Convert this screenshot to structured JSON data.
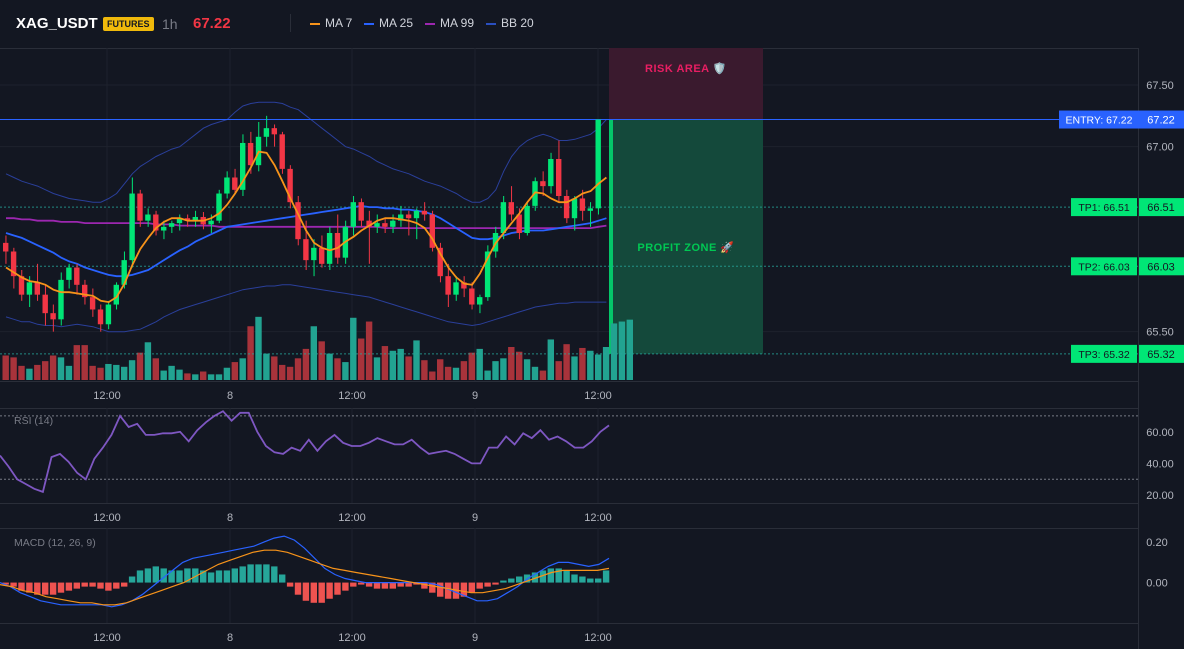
{
  "header": {
    "symbol": "XAG_USDT",
    "badge": "FUTURES",
    "timeframe": "1h",
    "price": "67.22",
    "legend": [
      {
        "label": "MA 7",
        "color": "#f7931a"
      },
      {
        "label": "MA 25",
        "color": "#2962ff"
      },
      {
        "label": "MA 99",
        "color": "#9c27b0"
      },
      {
        "label": "BB 20",
        "color": "#2a4fc0"
      }
    ]
  },
  "colors": {
    "up": "#00e676",
    "down": "#f23645",
    "up_vol": "#22a391",
    "down_vol": "#a8333b"
  },
  "chart_data": [
    {
      "type": "candlestick",
      "symbol": "XAG_USDT",
      "interval": "1h",
      "x_labels": [
        "12:00",
        "8",
        "12:00",
        "9",
        "12:00"
      ],
      "y_ticks": [
        "67.50",
        "67.00",
        "65.50"
      ],
      "ylim": [
        65.1,
        67.8
      ],
      "candles": [
        [
          66.22,
          66.28,
          66.05,
          66.15
        ],
        [
          66.15,
          66.18,
          65.85,
          65.95
        ],
        [
          65.95,
          66.0,
          65.75,
          65.8
        ],
        [
          65.8,
          65.95,
          65.7,
          65.9
        ],
        [
          65.9,
          66.05,
          65.75,
          65.8
        ],
        [
          65.8,
          65.88,
          65.55,
          65.65
        ],
        [
          65.65,
          65.72,
          65.5,
          65.6
        ],
        [
          65.6,
          65.98,
          65.55,
          65.92
        ],
        [
          65.92,
          66.05,
          65.85,
          66.02
        ],
        [
          66.02,
          66.05,
          65.8,
          65.88
        ],
        [
          65.88,
          65.92,
          65.72,
          65.78
        ],
        [
          65.78,
          65.85,
          65.62,
          65.68
        ],
        [
          65.68,
          65.72,
          65.5,
          65.56
        ],
        [
          65.56,
          65.75,
          65.52,
          65.72
        ],
        [
          65.72,
          65.9,
          65.68,
          65.88
        ],
        [
          65.88,
          66.15,
          65.85,
          66.08
        ],
        [
          66.08,
          66.75,
          66.02,
          66.62
        ],
        [
          66.62,
          66.65,
          66.35,
          66.4
        ],
        [
          66.4,
          66.5,
          66.35,
          66.45
        ],
        [
          66.45,
          66.48,
          66.28,
          66.32
        ],
        [
          66.32,
          66.4,
          66.25,
          66.35
        ],
        [
          66.35,
          66.4,
          66.3,
          66.38
        ],
        [
          66.38,
          66.45,
          66.32,
          66.42
        ],
        [
          66.42,
          66.45,
          66.35,
          66.4
        ],
        [
          66.4,
          66.48,
          66.35,
          66.43
        ],
        [
          66.43,
          66.47,
          66.33,
          66.37
        ],
        [
          66.37,
          66.45,
          66.3,
          66.4
        ],
        [
          66.4,
          66.65,
          66.38,
          66.62
        ],
        [
          66.62,
          66.8,
          66.58,
          66.75
        ],
        [
          66.75,
          66.82,
          66.62,
          66.65
        ],
        [
          66.65,
          67.1,
          66.6,
          67.03
        ],
        [
          67.03,
          67.12,
          66.78,
          66.85
        ],
        [
          66.85,
          67.2,
          66.8,
          67.08
        ],
        [
          67.08,
          67.25,
          67.0,
          67.15
        ],
        [
          67.15,
          67.18,
          67.0,
          67.1
        ],
        [
          67.1,
          67.12,
          66.78,
          66.82
        ],
        [
          66.82,
          66.85,
          66.5,
          66.55
        ],
        [
          66.55,
          66.6,
          66.2,
          66.25
        ],
        [
          66.25,
          66.4,
          66.0,
          66.08
        ],
        [
          66.08,
          66.25,
          65.95,
          66.18
        ],
        [
          66.18,
          66.28,
          66.02,
          66.05
        ],
        [
          66.05,
          66.35,
          66.0,
          66.3
        ],
        [
          66.3,
          66.45,
          66.05,
          66.1
        ],
        [
          66.1,
          66.4,
          66.05,
          66.35
        ],
        [
          66.35,
          66.6,
          66.28,
          66.55
        ],
        [
          66.55,
          66.58,
          66.35,
          66.4
        ],
        [
          66.4,
          66.48,
          66.05,
          66.35
        ],
        [
          66.35,
          66.45,
          66.3,
          66.38
        ],
        [
          66.38,
          66.42,
          66.3,
          66.35
        ],
        [
          66.35,
          66.45,
          66.3,
          66.4
        ],
        [
          66.4,
          66.52,
          66.35,
          66.45
        ],
        [
          66.45,
          66.48,
          66.28,
          66.42
        ],
        [
          66.42,
          66.5,
          66.25,
          66.48
        ],
        [
          66.48,
          66.55,
          66.4,
          66.45
        ],
        [
          66.45,
          66.48,
          66.15,
          66.18
        ],
        [
          66.18,
          66.22,
          65.9,
          65.95
        ],
        [
          65.95,
          66.05,
          65.7,
          65.8
        ],
        [
          65.8,
          65.95,
          65.75,
          65.9
        ],
        [
          65.9,
          65.95,
          65.78,
          65.85
        ],
        [
          65.85,
          65.9,
          65.68,
          65.72
        ],
        [
          65.72,
          65.8,
          65.65,
          65.78
        ],
        [
          65.78,
          66.2,
          65.75,
          66.15
        ],
        [
          66.15,
          66.35,
          66.1,
          66.3
        ],
        [
          66.3,
          66.6,
          66.25,
          66.55
        ],
        [
          66.55,
          66.68,
          66.4,
          66.45
        ],
        [
          66.45,
          66.5,
          66.25,
          66.3
        ],
        [
          66.3,
          66.55,
          66.28,
          66.52
        ],
        [
          66.52,
          66.75,
          66.48,
          66.72
        ],
        [
          66.72,
          66.8,
          66.6,
          66.68
        ],
        [
          66.68,
          66.95,
          66.62,
          66.9
        ],
        [
          66.9,
          67.05,
          66.55,
          66.6
        ],
        [
          66.6,
          66.65,
          66.38,
          66.42
        ],
        [
          66.42,
          66.6,
          66.32,
          66.58
        ],
        [
          66.58,
          66.65,
          66.4,
          66.48
        ],
        [
          66.48,
          66.55,
          66.35,
          66.5
        ],
        [
          66.5,
          67.22,
          66.45,
          67.22
        ]
      ],
      "volumes": [
        26,
        24,
        15,
        12,
        16,
        20,
        26,
        24,
        15,
        37,
        37,
        15,
        13,
        17,
        16,
        14,
        21,
        29,
        40,
        23,
        10,
        15,
        11,
        7,
        6,
        9,
        6,
        6,
        13,
        19,
        23,
        57,
        67,
        28,
        25,
        16,
        14,
        23,
        33,
        57,
        41,
        28,
        23,
        19,
        66,
        44,
        62,
        24,
        36,
        31,
        33,
        25,
        42,
        21,
        9,
        22,
        14,
        13,
        20,
        29,
        33,
        10,
        20,
        23,
        35,
        30,
        22,
        14,
        10,
        43,
        20,
        38,
        25,
        34,
        31,
        27,
        35,
        60,
        62,
        64
      ],
      "ma7": [
        66.02,
        65.98,
        65.94,
        65.91,
        65.9,
        65.88,
        65.84,
        65.82,
        65.82,
        65.81,
        65.8,
        65.79,
        65.75,
        65.74,
        65.78,
        65.89,
        66.04,
        66.17,
        66.26,
        66.34,
        66.39,
        66.42,
        66.42,
        66.4,
        66.4,
        66.4,
        66.42,
        66.46,
        66.53,
        66.62,
        66.72,
        66.83,
        66.96,
        66.95,
        66.85,
        66.72,
        66.58,
        66.45,
        66.32,
        66.22,
        66.18,
        66.16,
        66.18,
        66.23,
        66.27,
        66.32,
        66.36,
        66.4,
        66.42,
        66.42,
        66.41,
        66.4,
        66.38,
        66.34,
        66.25,
        66.13,
        66.02,
        65.94,
        65.89,
        65.88,
        65.97,
        66.1,
        66.22,
        66.3,
        66.38,
        66.46,
        66.55,
        66.63,
        66.62,
        66.58,
        66.55,
        66.55,
        66.58,
        66.62,
        66.64,
        66.7,
        66.75
      ],
      "ma25": [
        66.3,
        66.28,
        66.26,
        66.23,
        66.2,
        66.17,
        66.14,
        66.1,
        66.07,
        66.05,
        66.02,
        66.0,
        65.98,
        65.96,
        65.95,
        65.95,
        65.96,
        65.98,
        66.0,
        66.04,
        66.08,
        66.12,
        66.16,
        66.19,
        66.23,
        66.26,
        66.29,
        66.32,
        66.35,
        66.36,
        66.37,
        66.38,
        66.39,
        66.4,
        66.41,
        66.42,
        66.43,
        66.44,
        66.45,
        66.46,
        66.47,
        66.48,
        66.49,
        66.5,
        66.51,
        66.52,
        66.51,
        66.51,
        66.5,
        66.5,
        66.49,
        66.49,
        66.48,
        66.47,
        66.45,
        66.42,
        66.38,
        66.34,
        66.3,
        66.26,
        66.25,
        66.25,
        66.26,
        66.28,
        66.3,
        66.31,
        66.32,
        66.32,
        66.32,
        66.33,
        66.34,
        66.35,
        66.36,
        66.37,
        66.38,
        66.4,
        66.42
      ],
      "ma99": [
        66.42,
        66.42,
        66.41,
        66.41,
        66.4,
        66.4,
        66.4,
        66.39,
        66.39,
        66.39,
        66.38,
        66.38,
        66.38,
        66.38,
        66.38,
        66.38,
        66.38,
        66.38,
        66.38,
        66.37,
        66.37,
        66.37,
        66.36,
        66.36,
        66.36,
        66.36,
        66.36,
        66.35,
        66.35,
        66.35,
        66.35,
        66.35,
        66.35,
        66.35,
        66.35,
        66.35,
        66.35,
        66.35,
        66.35,
        66.35,
        66.35,
        66.35,
        66.35,
        66.35,
        66.35,
        66.35,
        66.35,
        66.35,
        66.34,
        66.34,
        66.34,
        66.34,
        66.34,
        66.34,
        66.34,
        66.34,
        66.34,
        66.34,
        66.34,
        66.34,
        66.34,
        66.34,
        66.34,
        66.34,
        66.34,
        66.34,
        66.34,
        66.34,
        66.34,
        66.34,
        66.34,
        66.34,
        66.34,
        66.34,
        66.34,
        66.35,
        66.36
      ],
      "bb_upper": [
        66.78,
        66.75,
        66.72,
        66.7,
        66.68,
        66.65,
        66.62,
        66.6,
        66.58,
        66.57,
        66.56,
        66.55,
        66.55,
        66.58,
        66.62,
        66.7,
        66.78,
        66.84,
        66.88,
        66.92,
        66.95,
        66.98,
        67.0,
        67.05,
        67.1,
        67.15,
        67.18,
        67.2,
        67.22,
        67.28,
        67.33,
        67.35,
        67.36,
        67.36,
        67.36,
        67.35,
        67.32,
        67.3,
        67.25,
        67.2,
        67.15,
        67.1,
        67.05,
        67.0,
        66.98,
        66.95,
        66.92,
        66.88,
        66.85,
        66.82,
        66.8,
        66.78,
        66.75,
        66.72,
        66.7,
        66.68,
        66.65,
        66.62,
        66.58,
        66.55,
        66.55,
        66.58,
        66.65,
        66.8,
        66.92,
        67.0,
        67.05,
        67.08,
        67.1,
        67.08,
        67.05,
        67.05,
        67.06,
        67.08,
        67.1,
        67.15,
        67.22
      ],
      "bb_lower": [
        65.62,
        65.6,
        65.58,
        65.58,
        65.56,
        65.55,
        65.55,
        65.54,
        65.55,
        65.56,
        65.55,
        65.54,
        65.52,
        65.5,
        65.5,
        65.5,
        65.51,
        65.52,
        65.55,
        65.58,
        65.62,
        65.65,
        65.68,
        65.7,
        65.72,
        65.74,
        65.76,
        65.78,
        65.8,
        65.82,
        65.84,
        65.85,
        65.86,
        65.87,
        65.87,
        65.88,
        65.88,
        65.87,
        65.86,
        65.85,
        65.84,
        65.83,
        65.82,
        65.81,
        65.8,
        65.79,
        65.78,
        65.76,
        65.74,
        65.72,
        65.7,
        65.68,
        65.66,
        65.64,
        65.62,
        65.6,
        65.58,
        65.57,
        65.56,
        65.55,
        65.56,
        65.58,
        65.6,
        65.62,
        65.64,
        65.66,
        65.68,
        65.7,
        65.71,
        65.72,
        65.73,
        65.73,
        65.74,
        65.74,
        65.74,
        65.74,
        65.74
      ],
      "entry_label": "ENTRY: 67.22",
      "entry_value": "67.22",
      "entry": 67.22,
      "targets": [
        {
          "label": "TP1: 66.51",
          "value_text": "66.51",
          "value": 66.51
        },
        {
          "label": "TP2: 66.03",
          "value_text": "66.03",
          "value": 66.03
        },
        {
          "label": "TP3: 65.32",
          "value_text": "65.32",
          "value": 65.32
        }
      ],
      "risk_label": "RISK AREA 🛡️",
      "profit_label": "PROFIT ZONE 🚀"
    },
    {
      "type": "line",
      "title": "RSI (14)",
      "x_labels": [
        "12:00",
        "8",
        "12:00",
        "9",
        "12:00"
      ],
      "y_ticks": [
        "60.00",
        "40.00",
        "20.00"
      ],
      "ylim": [
        15,
        75
      ],
      "values": [
        45,
        38,
        30,
        27,
        24,
        22,
        44,
        46,
        41,
        34,
        30,
        43,
        50,
        58,
        70,
        63,
        65,
        58,
        58,
        59,
        59,
        60,
        54,
        61,
        66,
        70,
        73,
        67,
        72,
        72,
        60,
        51,
        47,
        46,
        50,
        48,
        55,
        48,
        54,
        58,
        53,
        51,
        51,
        53,
        56,
        54,
        52,
        52,
        55,
        50,
        46,
        47,
        48,
        46,
        43,
        40,
        40,
        50,
        50,
        57,
        52,
        59,
        56,
        61,
        55,
        57,
        54,
        50,
        50,
        54,
        60,
        64
      ]
    },
    {
      "type": "bar",
      "title": "MACD (12, 26, 9)",
      "x_labels": [
        "12:00",
        "8",
        "12:00",
        "9",
        "12:00"
      ],
      "y_ticks": [
        "0.20",
        "0.00"
      ],
      "ylim": [
        -0.2,
        0.27
      ],
      "histogram": [
        -0.01,
        -0.02,
        -0.04,
        -0.05,
        -0.06,
        -0.06,
        -0.06,
        -0.05,
        -0.04,
        -0.03,
        -0.02,
        -0.02,
        -0.03,
        -0.04,
        -0.03,
        -0.02,
        0.03,
        0.06,
        0.07,
        0.08,
        0.07,
        0.06,
        0.06,
        0.07,
        0.07,
        0.06,
        0.05,
        0.06,
        0.06,
        0.07,
        0.08,
        0.09,
        0.09,
        0.09,
        0.08,
        0.04,
        -0.02,
        -0.06,
        -0.09,
        -0.1,
        -0.1,
        -0.08,
        -0.06,
        -0.04,
        -0.02,
        -0.01,
        -0.02,
        -0.03,
        -0.03,
        -0.03,
        -0.02,
        -0.02,
        -0.01,
        -0.03,
        -0.05,
        -0.07,
        -0.08,
        -0.08,
        -0.07,
        -0.05,
        -0.03,
        -0.02,
        -0.01,
        0.01,
        0.02,
        0.03,
        0.04,
        0.05,
        0.06,
        0.07,
        0.07,
        0.06,
        0.04,
        0.03,
        0.02,
        0.02,
        0.06
      ],
      "macd": [
        0.0,
        -0.02,
        -0.05,
        -0.07,
        -0.09,
        -0.1,
        -0.11,
        -0.11,
        -0.11,
        -0.11,
        -0.11,
        -0.12,
        -0.11,
        -0.09,
        -0.06,
        -0.02,
        0.02,
        0.06,
        0.1,
        0.12,
        0.13,
        0.14,
        0.15,
        0.16,
        0.17,
        0.18,
        0.2,
        0.22,
        0.23,
        0.21,
        0.17,
        0.12,
        0.07,
        0.04,
        0.02,
        0.01,
        0.0,
        0.0,
        0.0,
        0.0,
        0.0,
        0.0,
        0.0,
        -0.01,
        -0.03,
        -0.05,
        -0.07,
        -0.09,
        -0.09,
        -0.08,
        -0.05,
        -0.02,
        0.02,
        0.05,
        0.08,
        0.1,
        0.1,
        0.09,
        0.08,
        0.09,
        0.12
      ],
      "signal": [
        -0.01,
        -0.02,
        -0.04,
        -0.05,
        -0.07,
        -0.08,
        -0.09,
        -0.1,
        -0.1,
        -0.11,
        -0.11,
        -0.1,
        -0.08,
        -0.06,
        -0.04,
        -0.02,
        0.0,
        0.03,
        0.06,
        0.09,
        0.11,
        0.13,
        0.15,
        0.16,
        0.16,
        0.15,
        0.13,
        0.11,
        0.09,
        0.07,
        0.06,
        0.05,
        0.04,
        0.03,
        0.02,
        0.01,
        0.0,
        -0.01,
        -0.02,
        -0.03,
        -0.04,
        -0.05,
        -0.05,
        -0.04,
        -0.03,
        -0.01,
        0.01,
        0.03,
        0.05,
        0.06,
        0.06,
        0.06,
        0.06,
        0.07
      ]
    }
  ]
}
